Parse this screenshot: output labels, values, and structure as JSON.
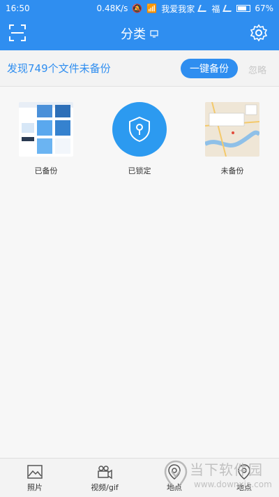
{
  "status_bar": {
    "time": "16:50",
    "speed": "0.48K/s",
    "carrier": "我爱我家",
    "carrier2": "福",
    "battery": "67%"
  },
  "header": {
    "title": "分类"
  },
  "banner": {
    "message": "发现749个文件未备份",
    "backup_label": "一键备份",
    "ignore_label": "忽略"
  },
  "categories": [
    {
      "label": "已备份"
    },
    {
      "label": "已锁定"
    },
    {
      "label": "未备份"
    }
  ],
  "bottom_nav": {
    "photos": "照片",
    "video": "视频/gif",
    "places": "地点",
    "places2": "地点"
  },
  "watermark": {
    "brand": "当下软件园",
    "url": "www.downxia.com"
  },
  "colors": {
    "primary": "#2f8ef0",
    "muted": "#c7c7c7"
  }
}
